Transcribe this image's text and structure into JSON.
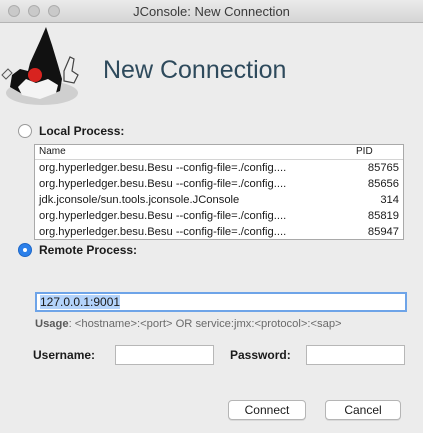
{
  "window": {
    "title": "JConsole: New Connection"
  },
  "heading": "New Connection",
  "local": {
    "label": "Local Process:",
    "columns": {
      "name": "Name",
      "pid": "PID"
    },
    "rows": [
      {
        "name": "org.hyperledger.besu.Besu --config-file=./config....",
        "pid": "85765"
      },
      {
        "name": "org.hyperledger.besu.Besu --config-file=./config....",
        "pid": "85656"
      },
      {
        "name": "jdk.jconsole/sun.tools.jconsole.JConsole",
        "pid": "314"
      },
      {
        "name": "org.hyperledger.besu.Besu --config-file=./config....",
        "pid": "85819"
      },
      {
        "name": "org.hyperledger.besu.Besu --config-file=./config....",
        "pid": "85947"
      }
    ]
  },
  "remote": {
    "label": "Remote Process:",
    "value": "127.0.0.1:9001",
    "usage_prefix": "Usage",
    "usage_text": ": <hostname>:<port> OR service:jmx:<protocol>:<sap>"
  },
  "credentials": {
    "username_label": "Username:",
    "password_label": "Password:"
  },
  "buttons": {
    "connect": "Connect",
    "cancel": "Cancel"
  },
  "colors": {
    "accent": "#2c80ea",
    "heading": "#2e4a5c"
  }
}
